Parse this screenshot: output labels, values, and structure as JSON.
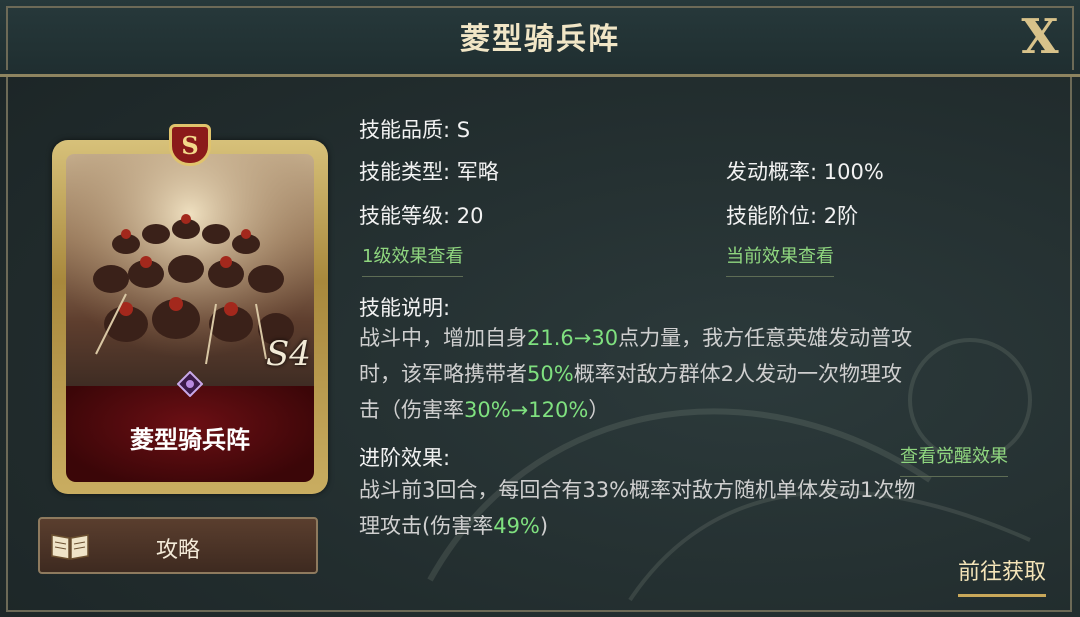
{
  "header": {
    "title": "菱型骑兵阵",
    "close_label": "X"
  },
  "card": {
    "quality_badge": "S",
    "name": "菱型骑兵阵",
    "level_mark": "S4"
  },
  "guide_button": {
    "label": "攻略"
  },
  "skill": {
    "quality_label": "技能品质: S",
    "type_label": "技能类型: 军略",
    "trigger_rate_label": "发动概率: 100%",
    "level_label": "技能等级: 20",
    "rank_label": "技能阶位: 2阶",
    "link_level1": "1级效果查看",
    "link_current": "当前效果查看",
    "description_title": "技能说明:",
    "description": {
      "line1_a": "战斗中，增加自身",
      "line1_hl": "21.6→30",
      "line1_b": "点力量，我方任意英雄发动普攻",
      "line2_a": "时，该军略携带者",
      "line2_hl": "50%",
      "line2_b": "概率对敌方群体2人发动一次物理攻",
      "line3_a": "击（伤害率",
      "line3_hl": "30%→120%",
      "line3_b": "）"
    },
    "advance_title": "进阶效果:",
    "link_awaken": "查看觉醒效果",
    "advance": {
      "line1": "战斗前3回合，每回合有33%概率对敌方随机单体发动1次物",
      "line2_a": "理攻击(伤害率",
      "line2_hl": "49%",
      "line2_b": ")"
    }
  },
  "goto_button": {
    "label": "前往获取"
  },
  "colors": {
    "accent_green": "#7fe07f",
    "gold": "#d8c28a",
    "card_red": "#6b0f14"
  },
  "icons": [
    "close-icon",
    "book-icon",
    "gem-icon",
    "quality-s-badge"
  ]
}
